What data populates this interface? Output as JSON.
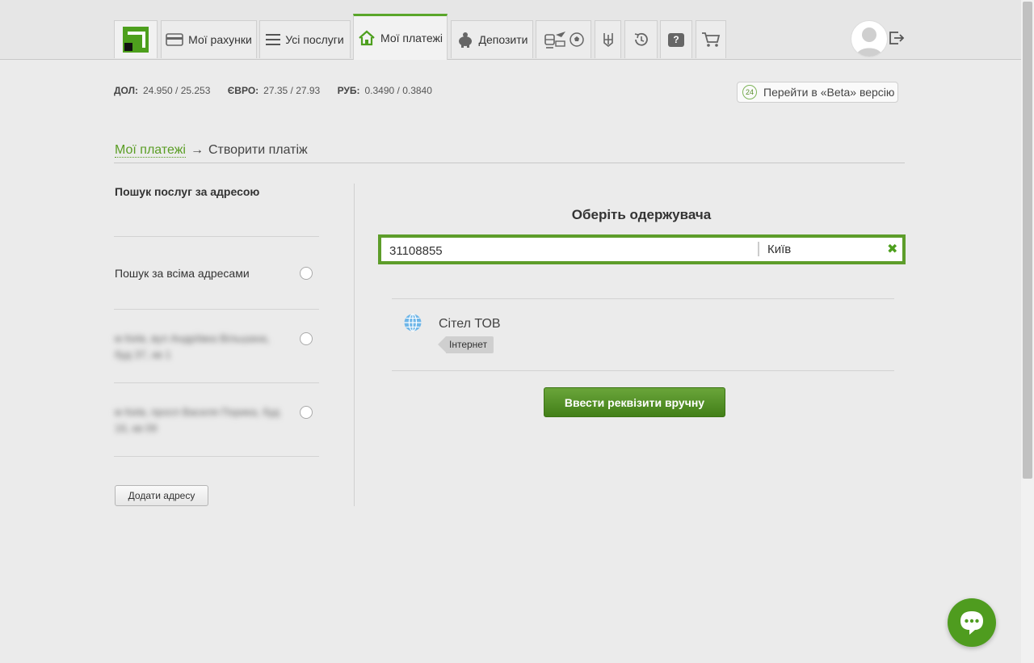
{
  "nav": {
    "tabs": [
      {
        "label": "Мої рахунки",
        "icon": "card-icon"
      },
      {
        "label": "Усі послуги",
        "icon": "list-icon"
      },
      {
        "label": "Мої платежі",
        "icon": "home-icon",
        "active": true
      },
      {
        "label": "Депозити",
        "icon": "piggy-bank-icon"
      }
    ],
    "help_label": "?"
  },
  "rates": [
    {
      "label": "ДОЛ:",
      "value": "24.950 / 25.253"
    },
    {
      "label": "ЄВРО:",
      "value": "27.35 / 27.93"
    },
    {
      "label": "РУБ:",
      "value": "0.3490 / 0.3840"
    }
  ],
  "beta": {
    "badge": "24",
    "label": "Перейти в «Beta» версію"
  },
  "breadcrumb": {
    "parent": "Мої платежі",
    "arrow": "→",
    "current": "Створити платіж"
  },
  "left": {
    "title": "Пошук послуг за адресою",
    "all_addresses": "Пошук за всіма адресами",
    "addresses": [
      "м Київ, вул Андріївка Вільшана, буд 37, кв 1",
      "м Київ, просп Василя Порика, буд 16, кв 09"
    ],
    "add_button": "Додати адресу"
  },
  "main": {
    "title": "Оберіть одержувача",
    "search_value": "31108855",
    "city": "Київ",
    "clear_symbol": "✖",
    "results": [
      {
        "name": "Сітел ТОВ",
        "tag": "Інтернет"
      }
    ],
    "manual_button": "Ввести реквізити вручну"
  },
  "colors": {
    "accent": "#5d9d2a",
    "button": "#4d8a22"
  }
}
